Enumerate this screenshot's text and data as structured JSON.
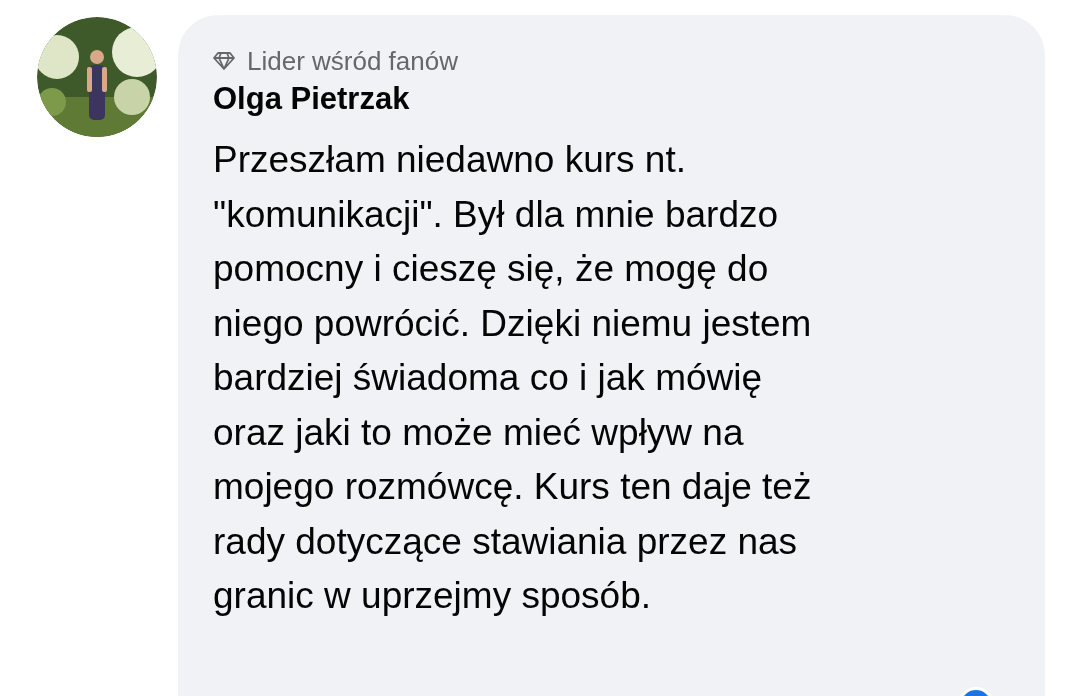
{
  "comment": {
    "badge": "Lider wśród fanów",
    "author": "Olga Pietrzak",
    "body_lines": [
      "Przeszłam niedawno kurs nt.",
      "\"komunikacji\". Był dla mnie bardzo",
      "pomocny i cieszę się, że mogę do",
      "niego powrócić. Dzięki niemu jestem",
      "bardziej świadoma co i jak mówię",
      "oraz jaki to może mieć wpływ na",
      "mojego rozmówcę. Kurs ten daje też",
      "rady dotyczące stawiania przez nas",
      "granic w uprzejmy sposób."
    ]
  }
}
